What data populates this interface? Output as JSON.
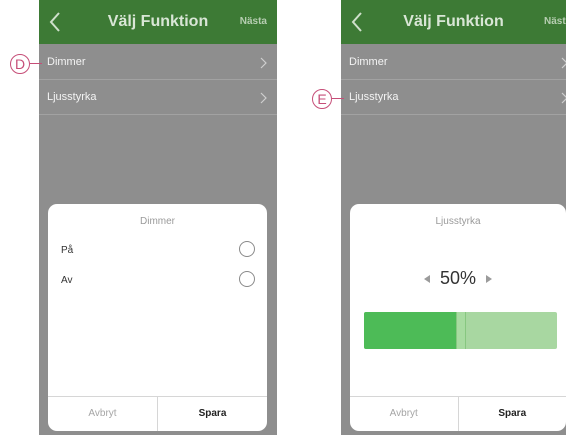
{
  "header": {
    "title": "Välj Funktion",
    "next_label": "Nästa"
  },
  "list": {
    "items": [
      {
        "label": "Dimmer"
      },
      {
        "label": "Ljusstyrka"
      }
    ]
  },
  "dimmer_sheet": {
    "title": "Dimmer",
    "options": [
      {
        "label": "På"
      },
      {
        "label": "Av"
      }
    ],
    "cancel_label": "Avbryt",
    "save_label": "Spara"
  },
  "brightness_sheet": {
    "title": "Ljusstyrka",
    "value_text": "50%",
    "level_percent": 50,
    "cancel_label": "Avbryt",
    "save_label": "Spara"
  },
  "callouts": {
    "d": "D",
    "e": "E"
  },
  "colors": {
    "header_green": "#3d7a35",
    "slider_fill": "#4dbb57",
    "slider_track": "#a8d7a1",
    "callout": "#c64e78"
  }
}
